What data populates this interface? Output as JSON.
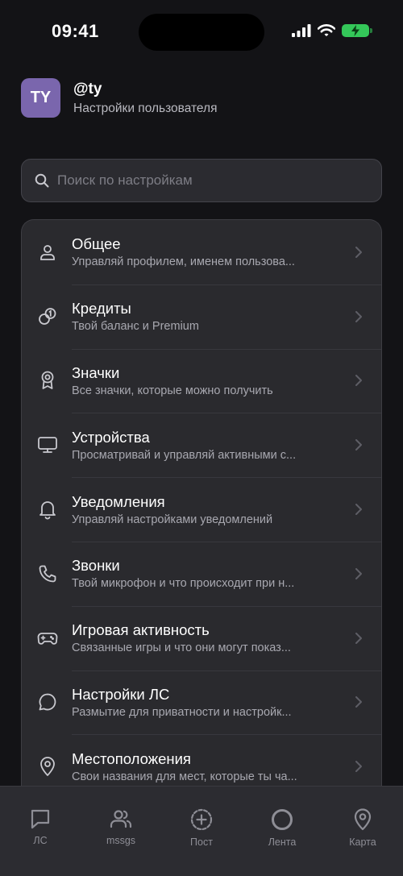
{
  "status_bar": {
    "time": "09:41"
  },
  "profile": {
    "avatar_initials": "TY",
    "username": "@ty",
    "subtitle": "Настройки пользователя"
  },
  "search": {
    "placeholder": "Поиск по настройкам"
  },
  "settings": [
    {
      "icon": "user-icon",
      "title": "Общее",
      "desc": "Управляй профилем, именем пользова..."
    },
    {
      "icon": "coins-icon",
      "title": "Кредиты",
      "desc": "Твой баланс и Premium"
    },
    {
      "icon": "badge-icon",
      "title": "Значки",
      "desc": "Все значки, которые можно получить"
    },
    {
      "icon": "monitor-icon",
      "title": "Устройства",
      "desc": "Просматривай и управляй активными с..."
    },
    {
      "icon": "bell-icon",
      "title": "Уведомления",
      "desc": "Управляй настройками уведомлений"
    },
    {
      "icon": "phone-icon",
      "title": "Звонки",
      "desc": "Твой микрофон и что происходит при н..."
    },
    {
      "icon": "gamepad-icon",
      "title": "Игровая активность",
      "desc": "Связанные игры и что они могут показ..."
    },
    {
      "icon": "chat-bubble-icon",
      "title": "Настройки ЛС",
      "desc": "Размытие для приватности и настройк..."
    },
    {
      "icon": "map-pin-icon",
      "title": "Местоположения",
      "desc": "Свои названия для мест, которые ты ча..."
    }
  ],
  "tabs": [
    {
      "icon": "message-square-icon",
      "label": "ЛС"
    },
    {
      "icon": "users-icon",
      "label": "mssgs"
    },
    {
      "icon": "plus-circle-icon",
      "label": "Пост"
    },
    {
      "icon": "circle-icon",
      "label": "Лента"
    },
    {
      "icon": "map-pin-icon",
      "label": "Карта"
    }
  ],
  "colors": {
    "background": "#131316",
    "card": "#2a2a2e",
    "avatar": "#7a66ad",
    "battery": "#34c759",
    "tab_inactive": "#8e8e96"
  }
}
